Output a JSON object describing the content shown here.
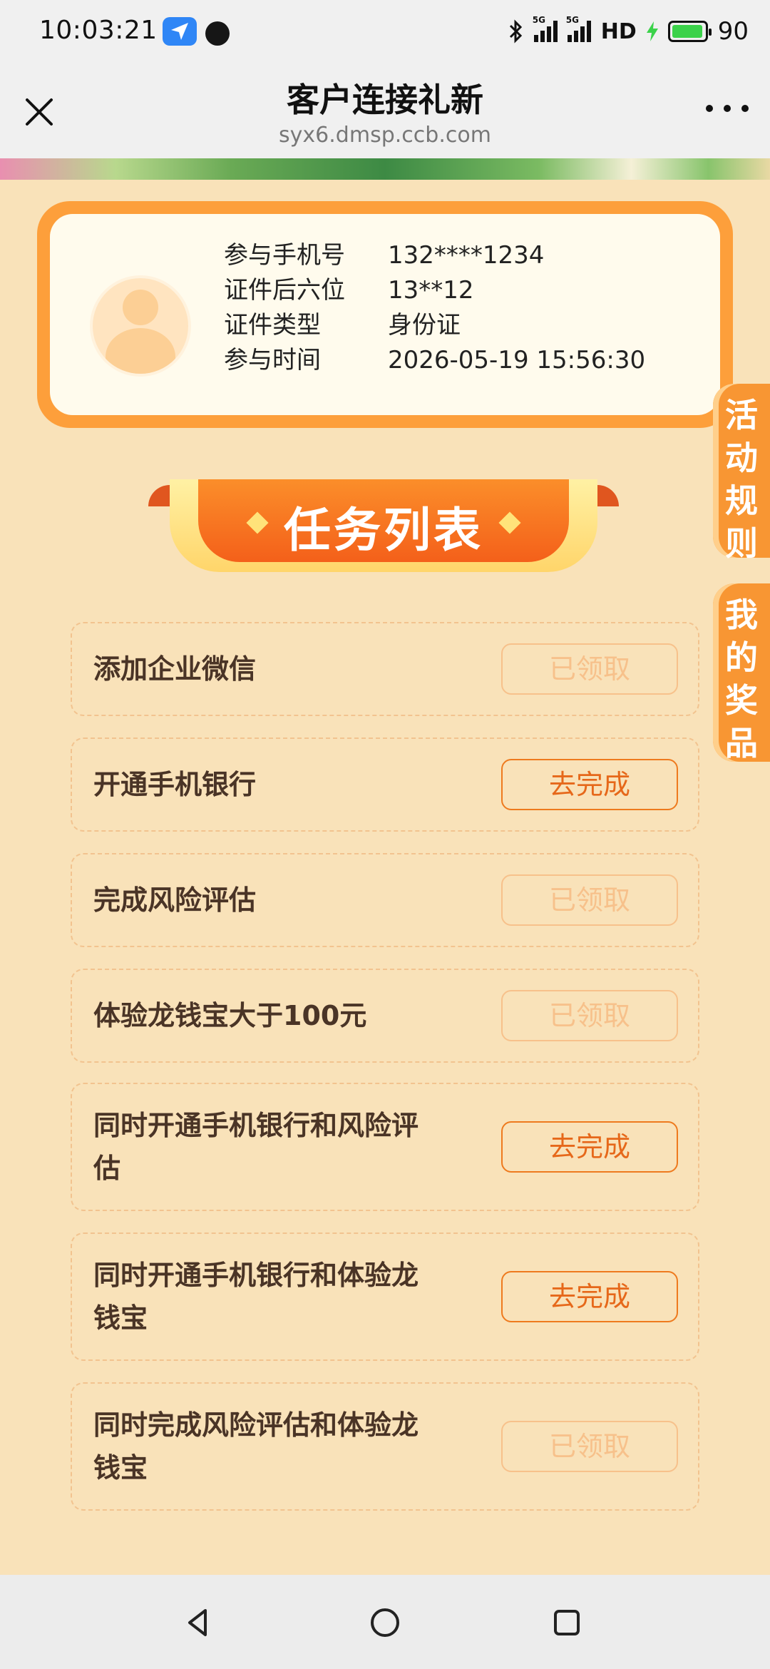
{
  "status_bar": {
    "time": "10:03:21",
    "network_label": "5G",
    "hd_label": "HD",
    "battery": "90"
  },
  "header": {
    "title": "客户连接礼新",
    "url": "syx6.dmsp.ccb.com"
  },
  "profile": {
    "rows": [
      {
        "label": "参与手机号",
        "value": "132****1234"
      },
      {
        "label": "证件后六位",
        "value": "13**12"
      },
      {
        "label": "证件类型",
        "value": "身份证"
      },
      {
        "label": "参与时间",
        "value": "2026-05-19 15:56:30"
      }
    ]
  },
  "task_list_title": "任务列表",
  "tasks": [
    {
      "name": "添加企业微信",
      "button": "已领取"
    },
    {
      "name": "开通手机银行",
      "button": "去完成"
    },
    {
      "name": "完成风险评估",
      "button": "已领取"
    },
    {
      "name": "体验龙钱宝大于100元",
      "button": "已领取"
    },
    {
      "name": "同时开通手机银行和风险评",
      "name2": "估",
      "button": "去完成"
    },
    {
      "name": "同时开通手机银行和体验龙",
      "name2": "钱宝",
      "button": "去完成"
    },
    {
      "name": "同时完成风险评估和体验龙",
      "name2": "钱宝",
      "button": "已领取"
    }
  ],
  "side_tabs": {
    "rules": "活动规则",
    "prizes": "我的奖品"
  },
  "colors": {
    "accent": "#f89633",
    "done_button": "#f7c18b",
    "todo_button": "#e6681a",
    "background": "#f9e2b9"
  }
}
